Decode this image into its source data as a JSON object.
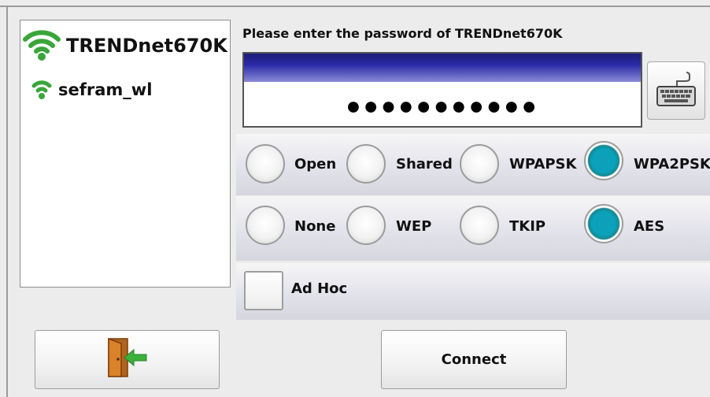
{
  "networks": [
    {
      "name": "TRENDnet670K",
      "signal_icon": "wifi-signal-strong-icon"
    },
    {
      "name": "sefram_wl",
      "signal_icon": "wifi-signal-weak-icon"
    }
  ],
  "password": {
    "prompt": "Please enter the password of TRENDnet670K",
    "masked_value": "●●●●●●●●●●●",
    "keyboard_icon": "keyboard-icon"
  },
  "security": {
    "options": [
      "Open",
      "Shared",
      "WPAPSK",
      "WPA2PSK"
    ],
    "selected": "WPA2PSK"
  },
  "encryption": {
    "options": [
      "None",
      "WEP",
      "TKIP",
      "AES"
    ],
    "selected": "AES"
  },
  "adhoc": {
    "label": "Ad Hoc",
    "checked": false
  },
  "buttons": {
    "exit_icon": "exit-door-icon",
    "connect_label": "Connect"
  },
  "colors": {
    "selected_radio": "#0aa2bb",
    "password_header": "#2a2aa8",
    "wifi_green": "#3aa63a"
  }
}
